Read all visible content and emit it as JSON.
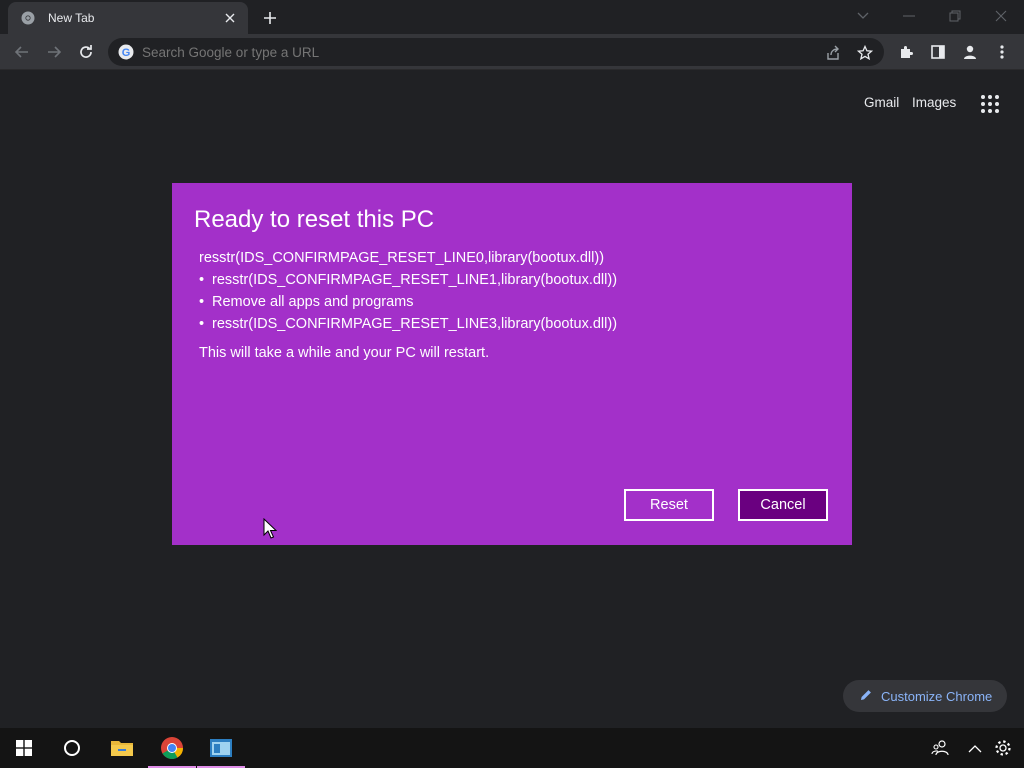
{
  "browser": {
    "tab_title": "New Tab",
    "omnibox_placeholder": "Search Google or type a URL"
  },
  "ntp": {
    "gmail_link": "Gmail",
    "images_link": "Images",
    "customize_label": "Customize Chrome"
  },
  "dialog": {
    "title": "Ready to reset this PC",
    "lines": [
      "resstr(IDS_CONFIRMPAGE_RESET_LINE0,library(bootux.dll))",
      "resstr(IDS_CONFIRMPAGE_RESET_LINE1,library(bootux.dll))",
      "Remove all apps and programs",
      "resstr(IDS_CONFIRMPAGE_RESET_LINE3,library(bootux.dll))"
    ],
    "bullet": "•",
    "note": "This will take a while and your PC will restart.",
    "reset_label": "Reset",
    "cancel_label": "Cancel"
  },
  "colors": {
    "dialog_bg": "#a330c9",
    "cancel_bg": "#6a0080",
    "browser_bg": "#202124",
    "toolbar_bg": "#35363a",
    "taskbar_bg": "#141414",
    "link_blue": "#8ab4f8"
  },
  "icons": {
    "tab": [
      "chrome-favicon-icon",
      "close-icon",
      "plus-icon"
    ],
    "window": [
      "chevron-down-icon",
      "minimize-icon",
      "restore-icon",
      "close-window-icon"
    ],
    "toolbar": [
      "back-icon",
      "forward-icon",
      "reload-icon",
      "google-g-icon",
      "share-icon",
      "star-icon",
      "extensions-icon",
      "side-panel-icon",
      "profile-icon",
      "more-icon"
    ],
    "taskbar": [
      "windows-start-icon",
      "cortana-icon",
      "file-explorer-icon",
      "chrome-icon",
      "reset-app-icon",
      "people-icon",
      "chevron-up-icon",
      "settings-gear-icon"
    ]
  }
}
